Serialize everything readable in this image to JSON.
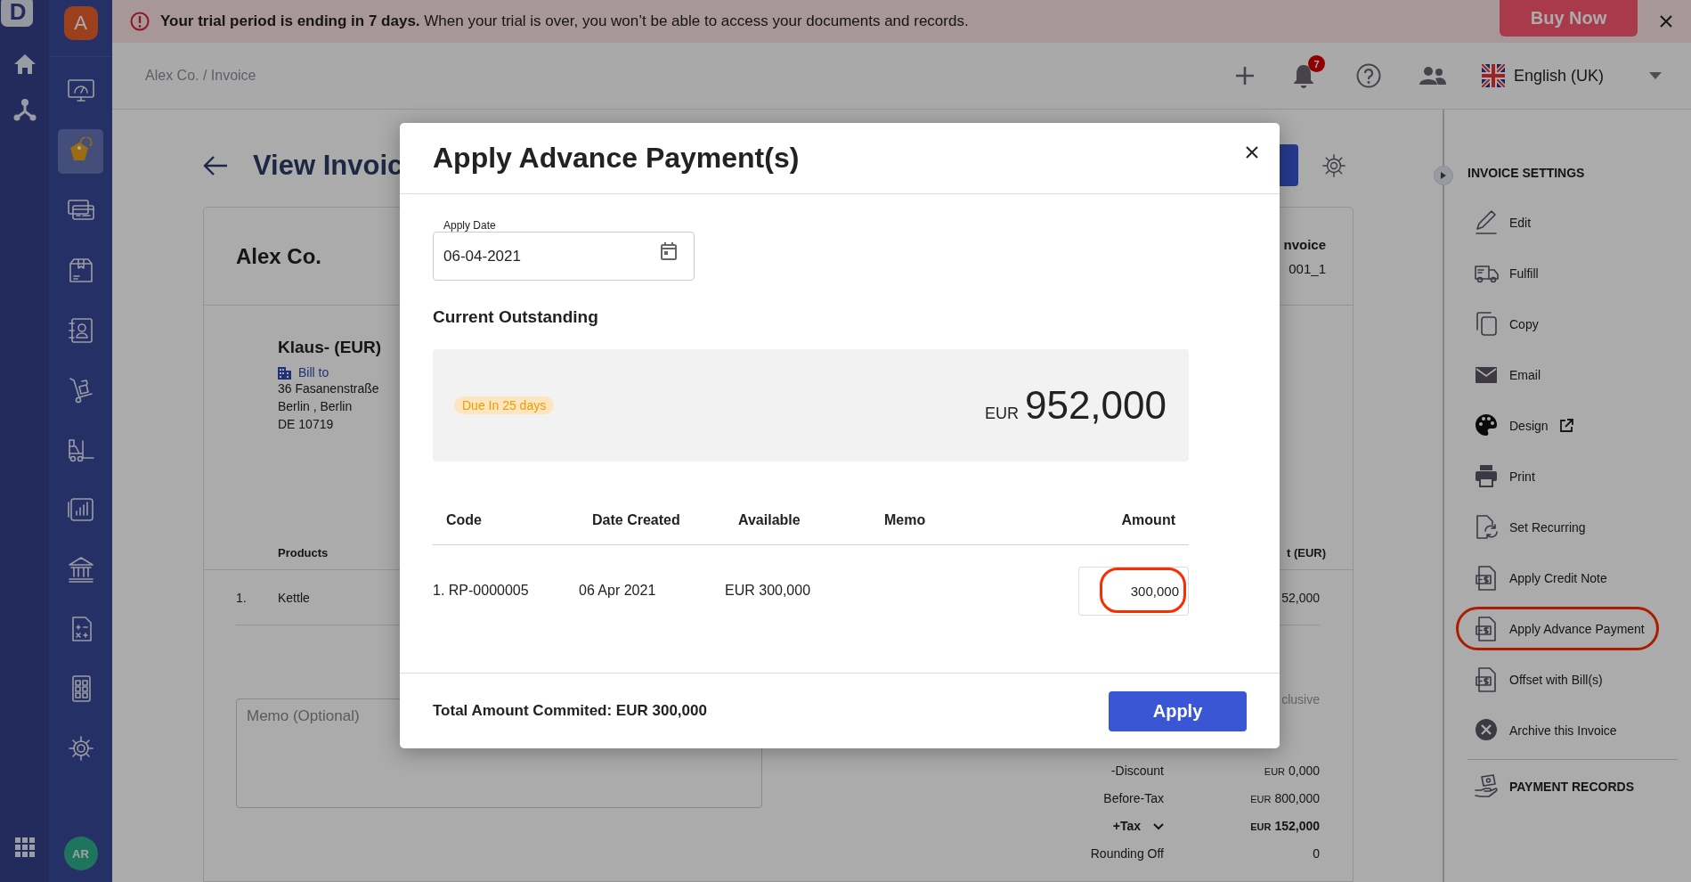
{
  "rail": {
    "logo": "D"
  },
  "nav": {
    "org_avatar": "A",
    "items": [
      {
        "selected": false
      },
      {
        "selected": true
      },
      {
        "selected": false
      },
      {
        "selected": false
      },
      {
        "selected": false
      },
      {
        "selected": false
      },
      {
        "selected": false
      },
      {
        "selected": false
      },
      {
        "selected": false
      },
      {
        "selected": false
      },
      {
        "selected": false
      },
      {
        "selected": false
      }
    ],
    "user_avatar": "AR"
  },
  "banner": {
    "message": "**Your trial period is ending in 7 days.** When your trial is over, you won’t be able to access your documents and records.",
    "buy_button": "Buy Now"
  },
  "header": {
    "breadcrumb": "Alex Co. / Invoice",
    "notification_count": "7",
    "language": "English (UK)"
  },
  "page": {
    "title": "View Invoic"
  },
  "invoice": {
    "company": "Alex Co.",
    "doc_title": "nvoice",
    "doc_number": "001_1",
    "customer": "Klaus- (EUR)",
    "bill_to_label": "Bill to",
    "address": [
      "36 Fasanenstraße",
      "Berlin , Berlin",
      "DE 10719"
    ],
    "columns": {
      "products": "Products",
      "amount": "t (EUR)"
    },
    "rows": [
      {
        "index": "1.",
        "product": "Kettle",
        "amount": "52,000"
      }
    ],
    "memo_placeholder": "Memo (Optional)",
    "tax_mode": "clusive",
    "totals": [
      {
        "kind": "plain",
        "label": "-Discount",
        "currency": "EUR",
        "value": "0,000"
      },
      {
        "kind": "plain",
        "label": "Before-Tax",
        "currency": "EUR",
        "value": "800,000"
      },
      {
        "kind": "expandable",
        "label": "+Tax",
        "currency": "EUR",
        "value": "152,000"
      },
      {
        "kind": "plain",
        "label": "Rounding Off",
        "value": "0"
      }
    ]
  },
  "settings": {
    "title": "INVOICE SETTINGS",
    "items": [
      {
        "kind": "action",
        "label": "Edit",
        "highlighted": false
      },
      {
        "kind": "action",
        "label": "Fulfill",
        "highlighted": false
      },
      {
        "kind": "action",
        "label": "Copy",
        "highlighted": false
      },
      {
        "kind": "action",
        "label": "Email",
        "highlighted": false
      },
      {
        "kind": "external",
        "label": "Design",
        "highlighted": false
      },
      {
        "kind": "action",
        "label": "Print",
        "highlighted": false
      },
      {
        "kind": "action",
        "label": "Set Recurring",
        "highlighted": false
      },
      {
        "kind": "action",
        "label": "Apply Credit Note",
        "highlighted": false
      },
      {
        "kind": "action",
        "label": "Apply Advance Payment",
        "highlighted": true
      },
      {
        "kind": "action",
        "label": "Offset with Bill(s)",
        "highlighted": false
      },
      {
        "kind": "action",
        "label": "Archive this Invoice",
        "highlighted": false
      }
    ],
    "records_label": "PAYMENT RECORDS"
  },
  "dialog": {
    "title": "Apply Advance Payment(s)",
    "date_label": "Apply Date",
    "date_value": "06-04-2021",
    "outstanding_heading": "Current Outstanding",
    "due_badge": "Due In 25 days",
    "outstanding_currency": "EUR",
    "outstanding_amount": "952,000",
    "columns": [
      "Code",
      "Date Created",
      "Available",
      "Memo",
      "Amount"
    ],
    "rows": [
      {
        "code": "1. RP-0000005",
        "date_created": "06 Apr 2021",
        "available": "EUR 300,000",
        "amount": "300,000",
        "highlighted": true
      }
    ],
    "total": "Total Amount Commited: EUR 300,000",
    "apply_button": "Apply"
  }
}
